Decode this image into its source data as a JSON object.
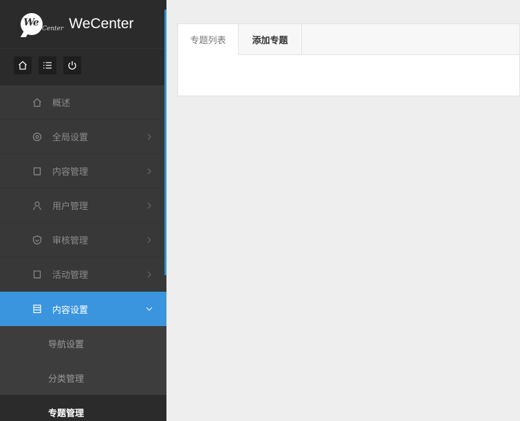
{
  "brand": {
    "badge": "We",
    "badge_sub": "Center",
    "name": "WeCenter"
  },
  "toolbar": {
    "icons": [
      "home-icon",
      "list-icon",
      "power-icon"
    ]
  },
  "sidebar": {
    "items": [
      {
        "label": "概述",
        "icon": "home-icon",
        "has_children": false
      },
      {
        "label": "全局设置",
        "icon": "gear-icon",
        "has_children": true
      },
      {
        "label": "内容管理",
        "icon": "document-icon",
        "has_children": true
      },
      {
        "label": "用户管理",
        "icon": "user-icon",
        "has_children": true
      },
      {
        "label": "审核管理",
        "icon": "shield-icon",
        "has_children": true
      },
      {
        "label": "活动管理",
        "icon": "document-icon",
        "has_children": true
      },
      {
        "label": "内容设置",
        "icon": "list-icon",
        "has_children": true,
        "expanded": true,
        "active": true
      }
    ],
    "sub_items": [
      {
        "label": "导航设置"
      },
      {
        "label": "分类管理"
      },
      {
        "label": "专题管理",
        "active": true
      }
    ]
  },
  "main": {
    "tabs": [
      {
        "label": "专题列表"
      },
      {
        "label": "添加专题"
      }
    ]
  },
  "colors": {
    "sidebar_bg": "#383838",
    "sidebar_dark": "#2b2b2b",
    "accent": "#3a95de",
    "page_bg": "#eeeeee"
  }
}
